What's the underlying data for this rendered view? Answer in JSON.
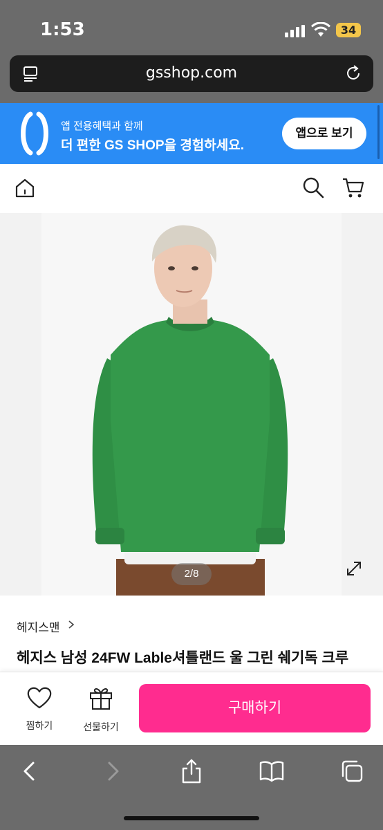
{
  "status_bar": {
    "time": "1:53",
    "battery": "34"
  },
  "browser": {
    "url": "gsshop.com"
  },
  "app_banner": {
    "line1": "앱 전용혜택과 함께",
    "line2": "더 편한 GS SHOP을 경험하세요.",
    "button_label": "앱으로 보기",
    "color": "#2a8cf5"
  },
  "header": {
    "icons": [
      "home-icon",
      "search-icon",
      "cart-icon"
    ]
  },
  "gallery": {
    "counter": "2/8"
  },
  "product": {
    "brand": "헤지스맨",
    "title": "헤지스 남성 24FW Lable셔틀랜드 울 그린 쉐기독 크루"
  },
  "actions": {
    "wish_label": "찜하기",
    "gift_label": "선물하기",
    "buy_label": "구매하기",
    "buy_color": "#ff2c8f"
  },
  "toolbar": {
    "icons": [
      "back-icon",
      "forward-icon",
      "share-icon",
      "bookmarks-icon",
      "tabs-icon"
    ]
  }
}
